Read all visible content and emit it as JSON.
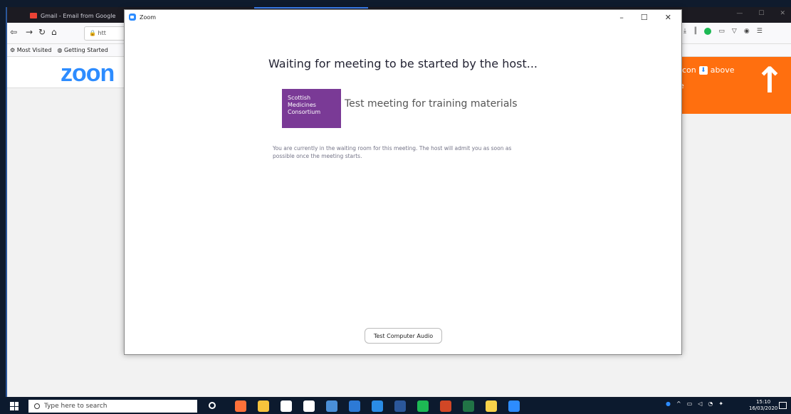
{
  "browser": {
    "tab_title": "Gmail - Email from Google",
    "url_partial": "htt",
    "bookmarks": {
      "most_visited": "Most Visited",
      "getting_started": "Getting Started"
    }
  },
  "page": {
    "zoom_logo": "zoon",
    "banner": {
      "text_left": "con",
      "text_right": "above",
      "text_line2": "e"
    }
  },
  "zoom_window": {
    "title": "Zoom",
    "controls": {
      "minimize": "–",
      "maximize": "☐",
      "close": "✕"
    },
    "waiting_title": "Waiting for meeting to be started by the host...",
    "host_logo_lines": [
      "Scottish",
      "Medicines",
      "Consortium"
    ],
    "meeting_topic": "Test meeting for training materials",
    "waiting_message": "You are currently in the waiting room for this meeting.  The host will admit you as soon as possible once the meeting starts.",
    "test_audio_button": "Test Computer Audio"
  },
  "taskbar": {
    "search_placeholder": "Type here to search",
    "time": "15:10",
    "date": "16/03/2020",
    "apps": [
      {
        "name": "firefox",
        "color": "#ff7139"
      },
      {
        "name": "file-explorer",
        "color": "#f6c33c"
      },
      {
        "name": "store",
        "color": "#ffffff"
      },
      {
        "name": "hp",
        "color": "#ffffff"
      },
      {
        "name": "app-blue",
        "color": "#4a8fd8"
      },
      {
        "name": "mail",
        "color": "#2d7ad6"
      },
      {
        "name": "edge",
        "color": "#2a8ce5"
      },
      {
        "name": "word",
        "color": "#2b579a"
      },
      {
        "name": "spotify",
        "color": "#1db954"
      },
      {
        "name": "powerpoint",
        "color": "#d24726"
      },
      {
        "name": "excel",
        "color": "#217346"
      },
      {
        "name": "sticky-notes",
        "color": "#f7d24a"
      },
      {
        "name": "zoom",
        "color": "#2d8cff"
      }
    ]
  },
  "colors": {
    "zoom_blue": "#2d8cff",
    "smc_purple": "#7a3a96",
    "banner_orange": "#ff6f0f"
  }
}
